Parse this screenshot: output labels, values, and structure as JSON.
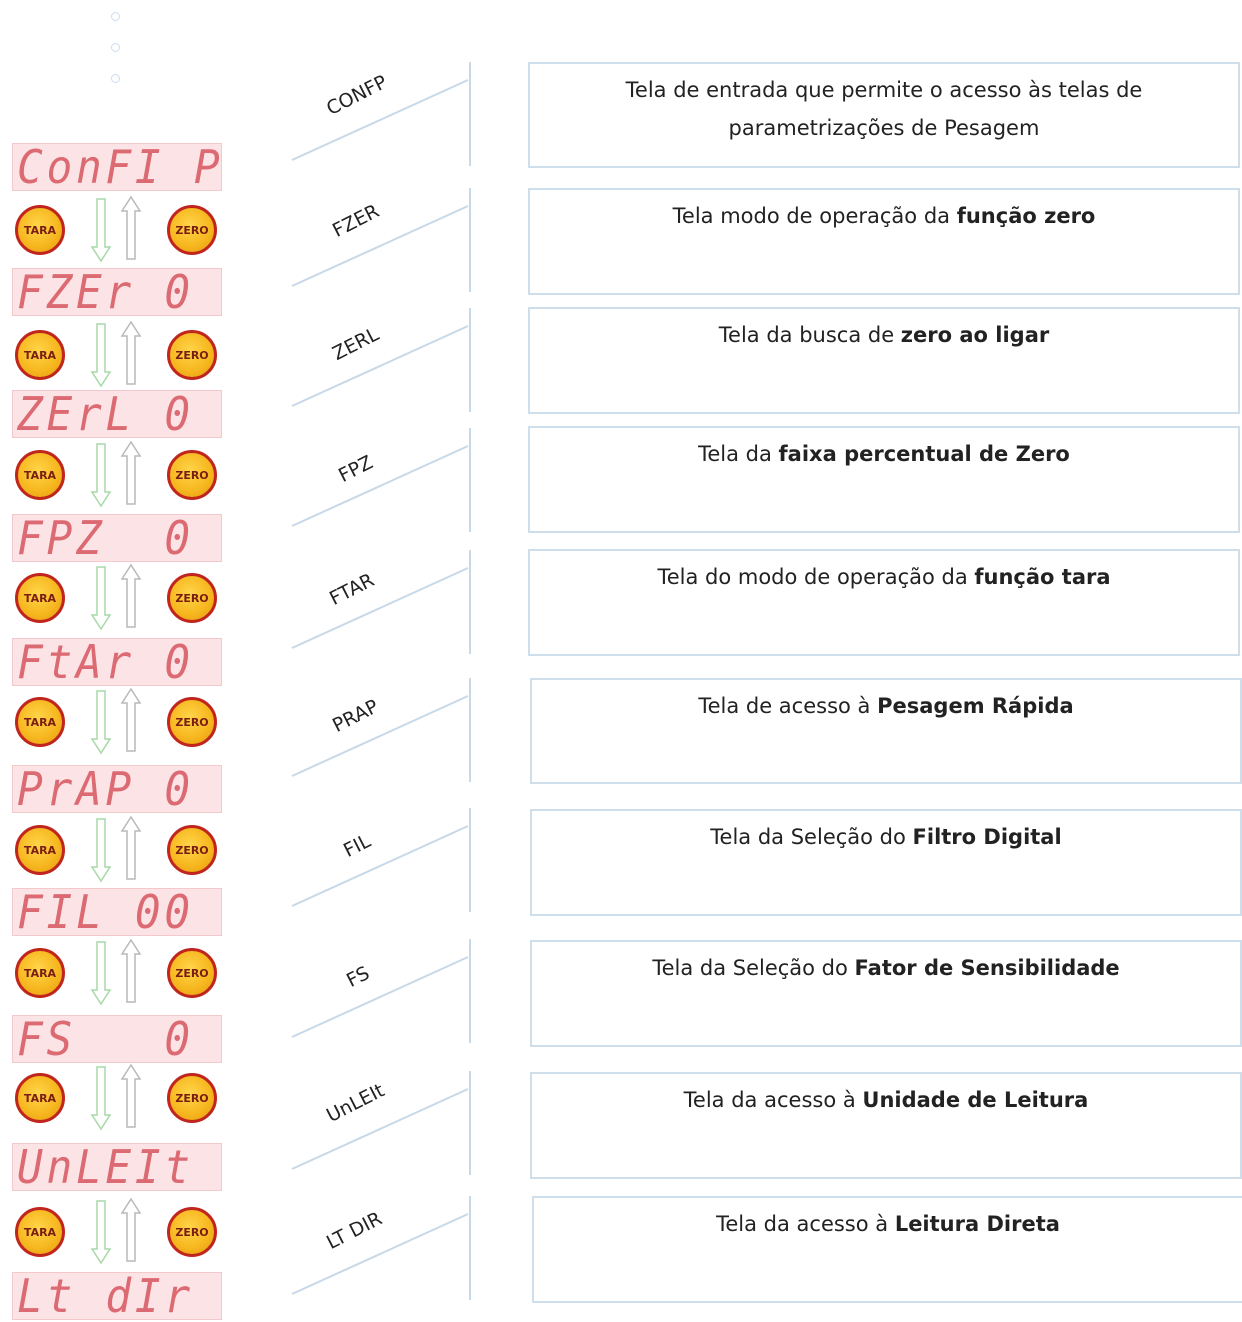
{
  "buttons": {
    "tara_label": "TARA",
    "zero_label": "ZERO"
  },
  "colors": {
    "display_bg": "#fce4e6",
    "segment": "#dc6a72",
    "button_fill": "#f7b820",
    "button_ring": "#c0261d",
    "down_arrow": "#a8d8a8",
    "up_arrow": "#b9b9b9",
    "panel_border": "#cfdeeb"
  },
  "icons": [
    "down-arrow-icon",
    "up-arrow-icon",
    "dot-icon"
  ],
  "steps": [
    {
      "display": "ConFI P",
      "code": "CONFP",
      "text_lines": [
        [
          {
            "t": "Tela de entrada que permite o acesso às telas de"
          }
        ],
        [
          {
            "t": "parametrizações de Pesagem"
          }
        ]
      ]
    },
    {
      "display": "FZEr 0",
      "code": "FZER",
      "text_lines": [
        [
          {
            "t": "Tela modo de operação da "
          },
          {
            "t": "função zero",
            "b": true
          }
        ]
      ]
    },
    {
      "display": "ZErL 0",
      "code": "ZERL",
      "text_lines": [
        [
          {
            "t": "Tela da busca de "
          },
          {
            "t": "zero ao ligar",
            "b": true
          }
        ]
      ]
    },
    {
      "display": "FPZ  0",
      "code": "FPZ",
      "text_lines": [
        [
          {
            "t": "Tela da "
          },
          {
            "t": "faixa percentual de Zero",
            "b": true
          }
        ]
      ]
    },
    {
      "display": "FtAr 0",
      "code": "FTAR",
      "text_lines": [
        [
          {
            "t": "Tela do modo de operação da "
          },
          {
            "t": "função tara",
            "b": true
          }
        ]
      ]
    },
    {
      "display": "PrAP 0",
      "code": "PRAP",
      "text_lines": [
        [
          {
            "t": "Tela de acesso à "
          },
          {
            "t": "Pesagem Rápida",
            "b": true
          }
        ]
      ]
    },
    {
      "display": "FIL 00",
      "code": "FIL",
      "text_lines": [
        [
          {
            "t": "Tela da Seleção do "
          },
          {
            "t": "Filtro Digital",
            "b": true
          }
        ]
      ]
    },
    {
      "display": "FS   0",
      "code": "FS",
      "text_lines": [
        [
          {
            "t": "Tela da Seleção do "
          },
          {
            "t": "Fator de Sensibilidade",
            "b": true
          }
        ]
      ]
    },
    {
      "display": "UnLEIt",
      "code": "UnLEIt",
      "text_lines": [
        [
          {
            "t": "Tela da acesso à "
          },
          {
            "t": "Unidade de Leitura",
            "b": true
          }
        ]
      ]
    },
    {
      "display": "Lt dIr",
      "code": "LT DIR",
      "text_lines": [
        [
          {
            "t": "Tela da acesso à "
          },
          {
            "t": "Leitura Direta",
            "b": true
          }
        ]
      ]
    }
  ]
}
